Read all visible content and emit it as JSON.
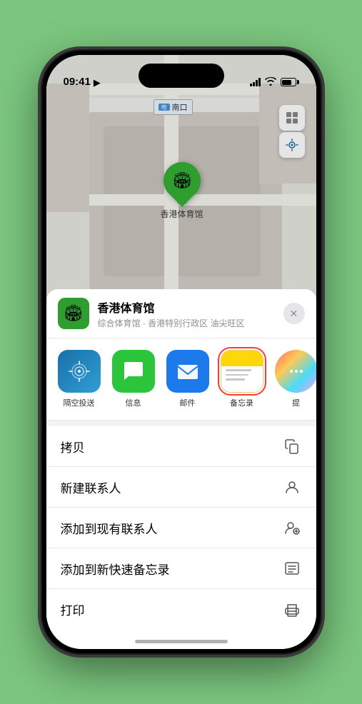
{
  "status_bar": {
    "time": "09:41",
    "location_icon": "▶"
  },
  "map": {
    "north_label": "南口",
    "pin_label": "香港体育馆",
    "controls": {
      "map_type_icon": "⊞",
      "location_icon": "➤"
    }
  },
  "location_card": {
    "name": "香港体育馆",
    "subtitle": "综合体育馆 · 香港特别行政区 油尖旺区",
    "close_label": "✕"
  },
  "apps": [
    {
      "id": "airdrop",
      "label": "隔空投送",
      "type": "airdrop"
    },
    {
      "id": "messages",
      "label": "信息",
      "type": "messages"
    },
    {
      "id": "mail",
      "label": "邮件",
      "type": "mail"
    },
    {
      "id": "notes",
      "label": "备忘录",
      "type": "notes"
    },
    {
      "id": "more",
      "label": "提",
      "type": "more"
    }
  ],
  "actions": [
    {
      "id": "copy",
      "label": "拷贝",
      "icon": "copy"
    },
    {
      "id": "new-contact",
      "label": "新建联系人",
      "icon": "person"
    },
    {
      "id": "add-contact",
      "label": "添加到现有联系人",
      "icon": "person-add"
    },
    {
      "id": "quick-note",
      "label": "添加到新快速备忘录",
      "icon": "note"
    },
    {
      "id": "print",
      "label": "打印",
      "icon": "print"
    }
  ]
}
